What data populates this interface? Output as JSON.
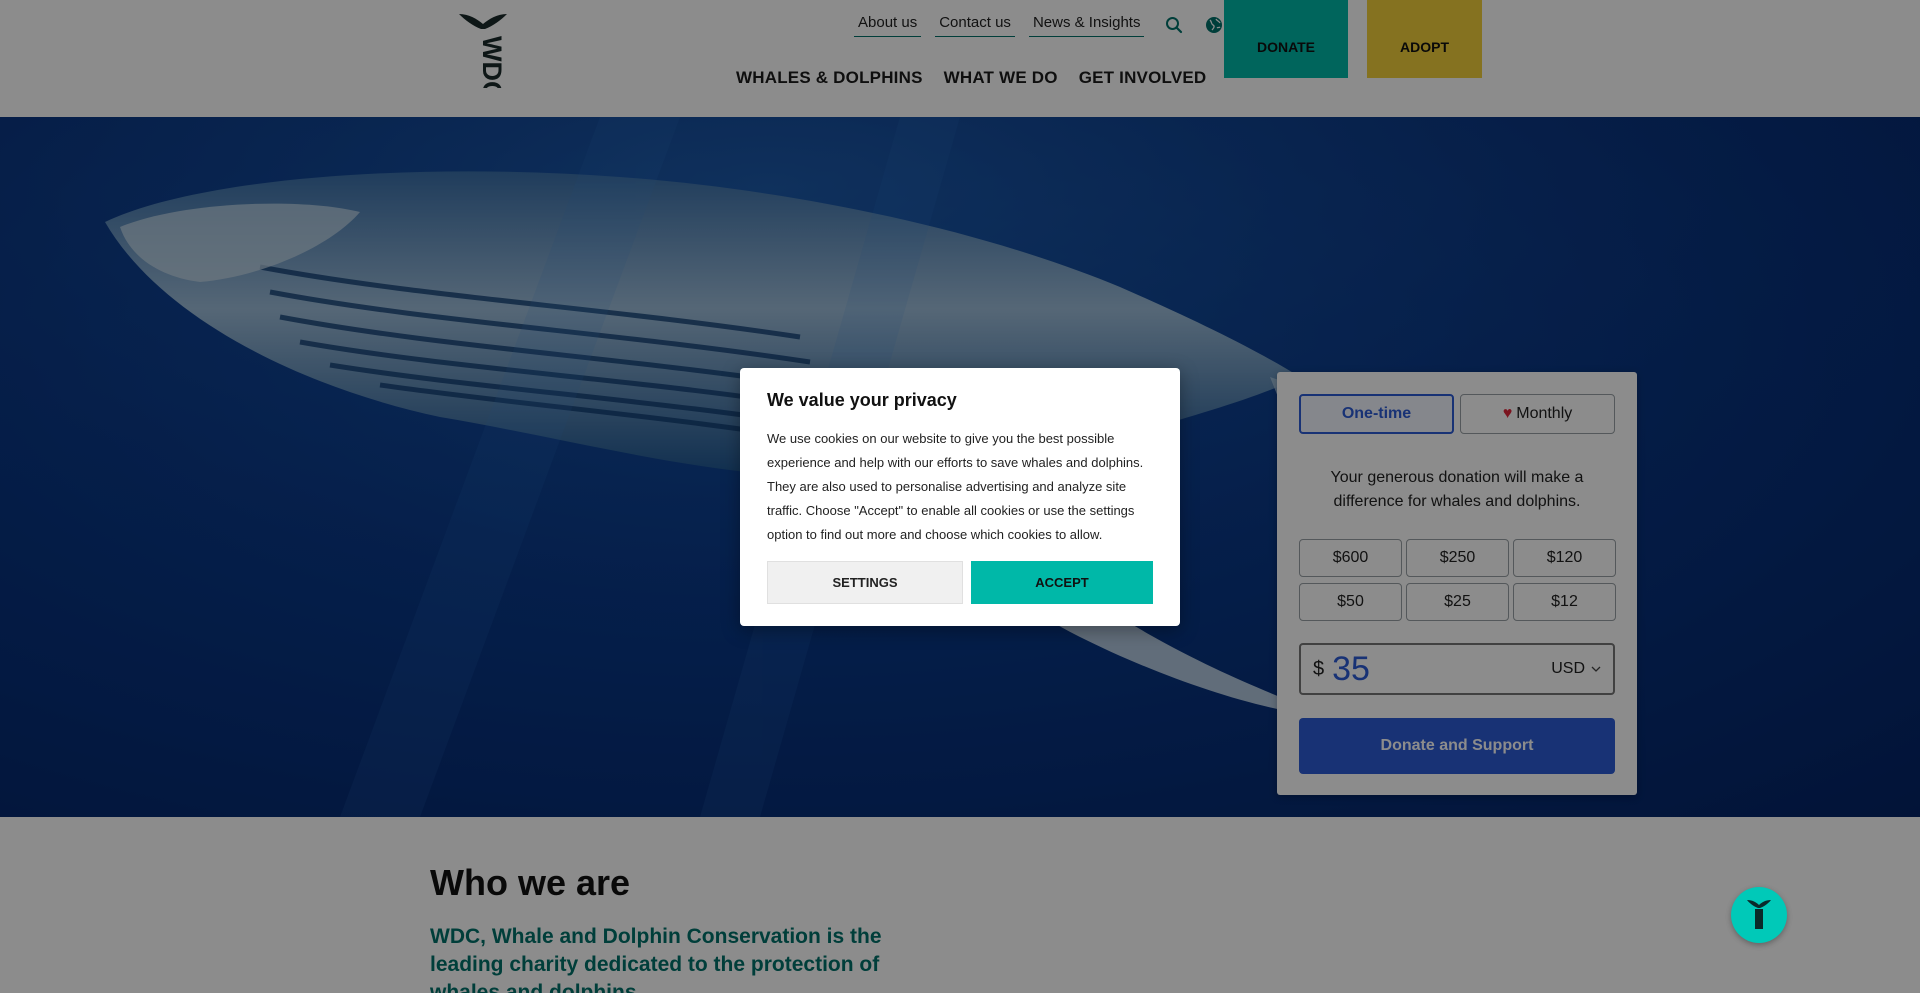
{
  "header": {
    "logo_text": "WDC",
    "top_links": [
      "About us",
      "Contact us",
      "News & Insights"
    ],
    "main_nav": [
      "WHALES & DOLPHINS",
      "WHAT WE DO",
      "GET INVOLVED"
    ],
    "donate_label": "DONATE",
    "adopt_label": "ADOPT",
    "colors": {
      "accent_teal": "#00b8a8",
      "adopt_yellow": "#f3cf3b",
      "brand_green": "#00726b"
    }
  },
  "donation": {
    "frequency": {
      "one_time": "One-time",
      "monthly": "Monthly",
      "selected": "One-time"
    },
    "message": "Your generous donation will make a difference for whales and dolphins.",
    "amounts": [
      "$600",
      "$250",
      "$120",
      "$50",
      "$25",
      "$12"
    ],
    "currency_symbol": "$",
    "amount_value": "35",
    "currency": "USD",
    "submit_label": "Donate and Support",
    "colors": {
      "primary_blue": "#2d5bd6"
    }
  },
  "who_we_are": {
    "heading": "Who we are",
    "intro": "WDC, Whale and Dolphin Conservation is the leading charity dedicated to the protection of whales and dolphins."
  },
  "cookie_modal": {
    "title": "We value your privacy",
    "body": "We use cookies on our website to give you the best possible experience and help with our efforts to save whales and dolphins. They are also used to personalise advertising and analyze site traffic. Choose \"Accept\" to enable all cookies or use the settings option to find out more and choose which cookies to allow.",
    "settings_label": "SETTINGS",
    "accept_label": "ACCEPT"
  },
  "icons": [
    "wdc-tail-logo",
    "search-icon",
    "globe-icon",
    "heart-icon",
    "chevron-down-icon",
    "chat-fab-icon"
  ]
}
